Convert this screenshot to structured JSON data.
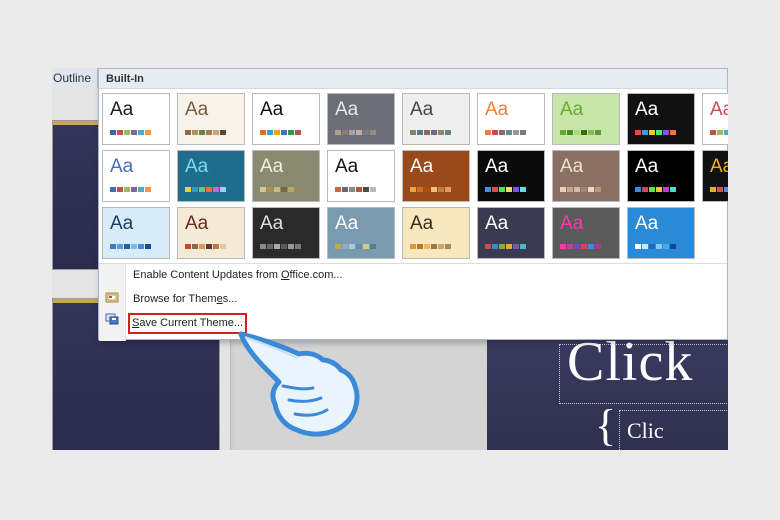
{
  "left_pane": {
    "outline_tab": "Outline"
  },
  "slide": {
    "title": "Click",
    "body": "Clic"
  },
  "theme_gallery": {
    "header": "Built-In",
    "tile_label": "Aa",
    "rows": [
      [
        {
          "bg": "#ffffff",
          "fg": "#1a1a1a",
          "sw": [
            "#3f5fa8",
            "#c0504d",
            "#9bbb59",
            "#8064a2",
            "#4bacc6",
            "#f79646"
          ]
        },
        {
          "bg": "#f7f3ea",
          "fg": "#7a5c3a",
          "sw": [
            "#8c6a45",
            "#b58f5c",
            "#6e7f4a",
            "#a67b4c",
            "#c7a27a",
            "#5b4632"
          ]
        },
        {
          "bg": "#ffffff",
          "fg": "#111111",
          "sw": [
            "#e86a1a",
            "#2fa3d6",
            "#f2a300",
            "#4472c4",
            "#2b9b4a",
            "#c0504d"
          ]
        },
        {
          "bg": "#6e6e78",
          "fg": "#e8e8e8",
          "sw": [
            "#b0a090",
            "#8c7a6a",
            "#a0a0a8",
            "#c0b0a0",
            "#7a7a84",
            "#9a8a7a"
          ]
        },
        {
          "bg": "#efefef",
          "fg": "#444444",
          "sw": [
            "#7a8a6a",
            "#5a7a8a",
            "#8a6a5a",
            "#6a6a8a",
            "#8a8a5a",
            "#5a8a7a"
          ]
        },
        {
          "bg": "#ffffff",
          "fg": "#e8823a",
          "sw": [
            "#e8823a",
            "#c0504d",
            "#8a6a5a",
            "#6a8a9a",
            "#9a9a9a",
            "#7a7a7a"
          ]
        },
        {
          "bg": "#c8e6a8",
          "fg": "#6aa832",
          "sw": [
            "#6aa832",
            "#4e8a2a",
            "#a8d878",
            "#3a6a1a",
            "#88b858",
            "#5a9a3a"
          ]
        },
        {
          "bg": "#111111",
          "fg": "#ffffff",
          "sw": [
            "#e84a3a",
            "#3a9ae8",
            "#e8c83a",
            "#4ae87a",
            "#9a4ae8",
            "#e87a3a"
          ]
        },
        {
          "bg": "#ffffff",
          "fg": "#c0504d",
          "sw": [
            "#c0504d",
            "#9bbb59",
            "#4bacc6",
            "#f79646",
            "#8064a2",
            "#4f81bd"
          ]
        }
      ],
      [
        {
          "bg": "#ffffff",
          "fg": "#3f6fb8",
          "sw": [
            "#3f6fb8",
            "#c0504d",
            "#9bbb59",
            "#8064a2",
            "#4bacc6",
            "#f79646"
          ]
        },
        {
          "bg": "#1f6d8e",
          "fg": "#7fd8f0",
          "sw": [
            "#ffcc33",
            "#3399cc",
            "#66cc66",
            "#ff6633",
            "#cc66cc",
            "#99ccff"
          ]
        },
        {
          "bg": "#8a8a70",
          "fg": "#f2f0e0",
          "sw": [
            "#d8c890",
            "#a89060",
            "#c8b880",
            "#786848",
            "#b8a870",
            "#988858"
          ]
        },
        {
          "bg": "#ffffff",
          "fg": "#111111",
          "sw": [
            "#c8664a",
            "#6a6a6a",
            "#8a8a8a",
            "#aa5a3a",
            "#4a4a4a",
            "#bababa"
          ]
        },
        {
          "bg": "#9a4a1a",
          "fg": "#ffffff",
          "sw": [
            "#f0a040",
            "#d07020",
            "#b05010",
            "#f0c080",
            "#c08040",
            "#e0a060"
          ]
        },
        {
          "bg": "#0a0a0a",
          "fg": "#ffffff",
          "sw": [
            "#4a8ae8",
            "#e84a4a",
            "#4ae84a",
            "#e8e84a",
            "#8a4ae8",
            "#4ae8e8"
          ]
        },
        {
          "bg": "#8a7060",
          "fg": "#f0e0d0",
          "sw": [
            "#e8d0b8",
            "#c0a890",
            "#d8b8a0",
            "#a08878",
            "#f0d8c0",
            "#b89880"
          ]
        },
        {
          "bg": "#000000",
          "fg": "#ffffff",
          "sw": [
            "#3a8ae8",
            "#e83a5a",
            "#5ae83a",
            "#e8c83a",
            "#c83ae8",
            "#3ae8c8"
          ]
        },
        {
          "bg": "#111111",
          "fg": "#f0b020",
          "sw": [
            "#f0b020",
            "#e84a3a",
            "#3a9ae8",
            "#4ae87a",
            "#c83ae8",
            "#e8e83a"
          ]
        }
      ],
      [
        {
          "bg": "#d8ecf8",
          "fg": "#1a3a6a",
          "sw": [
            "#3a7ac8",
            "#5a9ad8",
            "#2a5aa8",
            "#7abae8",
            "#4a8ad8",
            "#1a4a98"
          ]
        },
        {
          "bg": "#f4ead8",
          "fg": "#6a2a1a",
          "sw": [
            "#c04a2a",
            "#8a6a4a",
            "#d89a5a",
            "#5a3a2a",
            "#b87a4a",
            "#e8c89a"
          ]
        },
        {
          "bg": "#2a2a2a",
          "fg": "#e0e0e0",
          "sw": [
            "#8a8a8a",
            "#6a6a6a",
            "#aaaaaa",
            "#5a5a5a",
            "#9a9a9a",
            "#7a7a7a"
          ]
        },
        {
          "bg": "#7a9ab0",
          "fg": "#ffffff",
          "sw": [
            "#caa84a",
            "#8ab0c8",
            "#a8c8d8",
            "#6a8aa0",
            "#d8c88a",
            "#5a7a90"
          ]
        },
        {
          "bg": "#f8e8c0",
          "fg": "#3a2a1a",
          "sw": [
            "#d89a3a",
            "#b87a2a",
            "#e8b85a",
            "#987a4a",
            "#c8a86a",
            "#a88a5a"
          ]
        },
        {
          "bg": "#3a3a50",
          "fg": "#ffffff",
          "sw": [
            "#c0504d",
            "#3a8ac8",
            "#8aaa4a",
            "#e8a83a",
            "#7a5aa8",
            "#4ab8c8"
          ]
        },
        {
          "bg": "#5a5a5a",
          "fg": "#ff3aa8",
          "sw": [
            "#ff3aa8",
            "#c83a8a",
            "#8a3ac8",
            "#e83a5a",
            "#3a8ae8",
            "#aa3a8a"
          ]
        },
        {
          "bg": "#2a8ad8",
          "fg": "#ffffff",
          "sw": [
            "#ffffff",
            "#cce8ff",
            "#1a6ab8",
            "#88c8f8",
            "#4aa8e8",
            "#0a4a98"
          ]
        }
      ]
    ]
  },
  "commands": {
    "enable_updates_pre": "Enable Content Updates from ",
    "enable_updates_key": "O",
    "enable_updates_post": "ffice.com...",
    "browse_pre": "Browse for Them",
    "browse_key": "e",
    "browse_post": "s...",
    "save_key": "S",
    "save_post": "ave Current Theme..."
  },
  "colors": {
    "highlight_box": "#d42020",
    "hand_outline": "#3a8ad8"
  }
}
